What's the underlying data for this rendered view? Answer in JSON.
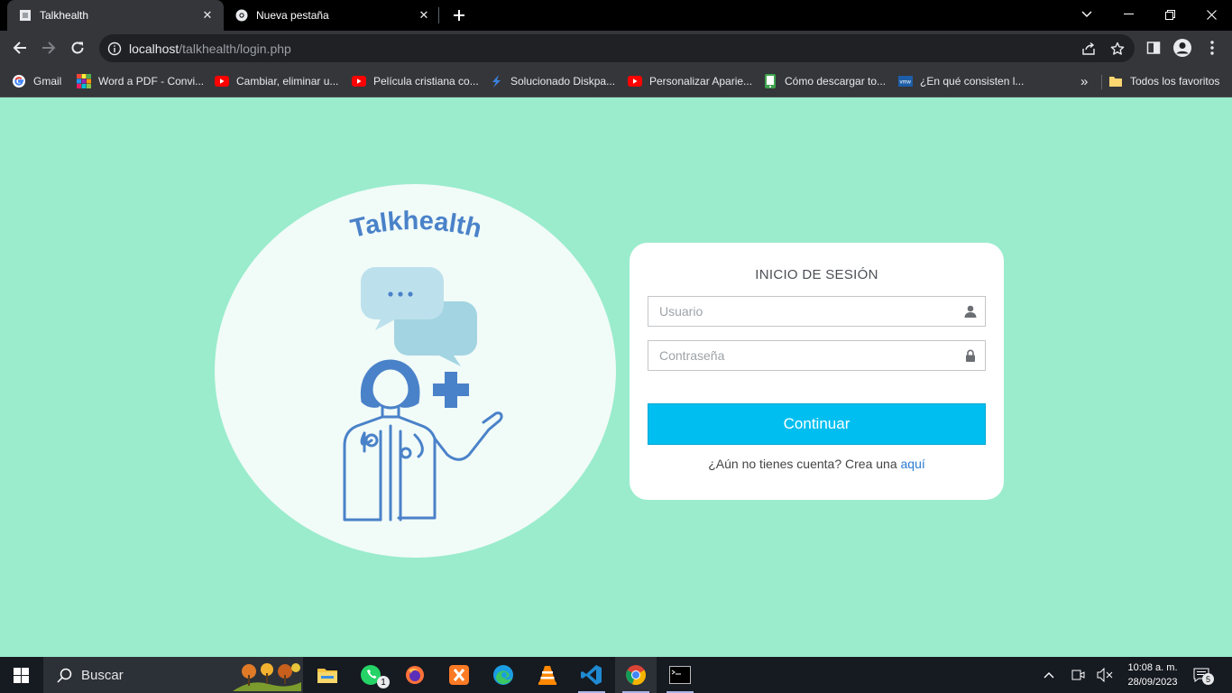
{
  "browser": {
    "tabs": [
      {
        "title": "Talkhealth",
        "active": true
      },
      {
        "title": "Nueva pestaña",
        "active": false
      }
    ],
    "url": {
      "host": "localhost",
      "path": "/talkhealth/login.php"
    },
    "bookmarks": [
      {
        "label": "Gmail",
        "icon": "google-icon"
      },
      {
        "label": "Word a PDF - Convi...",
        "icon": "ilovepdf-icon"
      },
      {
        "label": "Cambiar, eliminar u...",
        "icon": "youtube-icon"
      },
      {
        "label": "Película cristiana co...",
        "icon": "youtube-icon"
      },
      {
        "label": "Solucionado Diskpa...",
        "icon": "diskpart-icon"
      },
      {
        "label": "Personalizar Aparie...",
        "icon": "youtube-icon"
      },
      {
        "label": "Cómo descargar to...",
        "icon": "phone-icon"
      },
      {
        "label": "¿En qué consisten l...",
        "icon": "vmware-icon"
      }
    ],
    "all_bookmarks": "Todos los favoritos",
    "overflow": "»"
  },
  "page": {
    "logo_text": "Talkhealth",
    "login": {
      "title": "INICIO DE SESIÓN",
      "user_placeholder": "Usuario",
      "password_placeholder": "Contraseña",
      "submit_label": "Continuar",
      "signup_text": "¿Aún no tienes cuenta? Crea una ",
      "signup_link": "aquí"
    },
    "colors": {
      "background": "#9aeccc",
      "button": "#00bff0",
      "brand_blue": "#4a82c9"
    }
  },
  "taskbar": {
    "search_label": "Buscar",
    "whatsapp_badge": "1",
    "time": "10:08 a. m.",
    "date": "28/09/2023",
    "notification_count": "5"
  }
}
